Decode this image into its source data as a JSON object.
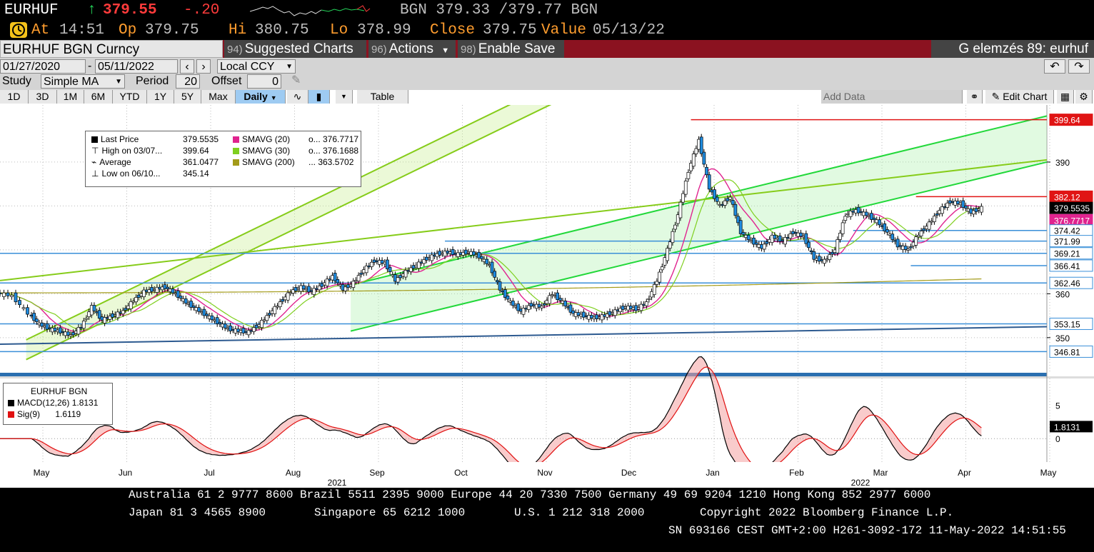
{
  "ticker": {
    "symbol": "EURHUF",
    "arrow": "↑",
    "last": "379.55",
    "change": "-.20",
    "bid_ask": "BGN 379.33 /379.77 BGN",
    "at_label": "At",
    "at": "14:51",
    "op_label": "Op",
    "op": "379.75",
    "hi_label": "Hi",
    "hi": "380.75",
    "lo_label": "Lo",
    "lo": "378.99",
    "close_label": "Close",
    "close": "379.75",
    "value_label": "Value",
    "value": "05/13/22"
  },
  "commandbar": {
    "security": "EURHUF BGN Curncy",
    "suggested_num": "94)",
    "suggested": "Suggested Charts",
    "actions_num": "96)",
    "actions": "Actions",
    "enable_num": "98)",
    "enable": "Enable Save",
    "right_title": "G elemzés 89: eurhuf"
  },
  "toolbar": {
    "date_from": "01/27/2020",
    "date_sep": "-",
    "date_to": "05/11/2022",
    "currency": "Local CCY",
    "study_label": "Study",
    "study": "Simple MA",
    "period_label": "Period",
    "period": "20",
    "offset_label": "Offset",
    "offset": "0",
    "ranges": [
      "1D",
      "3D",
      "1M",
      "6M",
      "YTD",
      "1Y",
      "5Y",
      "Max"
    ],
    "freq": "Daily",
    "table": "Table",
    "add_data": "Add Data",
    "edit_chart": "Edit Chart"
  },
  "colors": {
    "price_up": "#ffffff",
    "price_down": "#1f8ce0",
    "sma20": "#e0238f",
    "sma30": "#7fcf1f",
    "sma200": "#a39b1a",
    "macd": "#000000",
    "signal": "#e01010",
    "channel_green": "#22d83a",
    "channel_lime": "#86cc1a",
    "support_blue": "#3a8fd8"
  },
  "chart_data": [
    {
      "type": "candlestick",
      "title": "",
      "x_axis": {
        "months": [
          "May",
          "Jun",
          "Jul",
          "Aug",
          "Sep",
          "Oct",
          "Nov",
          "Dec",
          "Jan",
          "Feb",
          "Mar",
          "Apr",
          "May"
        ],
        "years": [
          "2021",
          "2022"
        ]
      },
      "y_axis": {
        "ticks": [
          350,
          360,
          390
        ],
        "ylim": [
          342,
          403
        ]
      },
      "legend_position": "top-left",
      "legend": [
        {
          "label": "Last Price",
          "value": "379.5535"
        },
        {
          "label": "High on 03/07...",
          "value": "399.64"
        },
        {
          "label": "Average",
          "value": "361.0477"
        },
        {
          "label": "Low on 06/10...",
          "value": "345.14"
        },
        {
          "label": "SMAVG (20)",
          "value": "o... 376.7717"
        },
        {
          "label": "SMAVG (30)",
          "value": "o... 376.1688"
        },
        {
          "label": "SMAVG (200)",
          "value": "... 363.5702"
        }
      ],
      "price_labels": [
        {
          "value": "399.64",
          "level": 399.64,
          "color": "#e01414"
        },
        {
          "value": "382.12",
          "level": 382.12,
          "color": "#e01414"
        },
        {
          "value": "379.5535",
          "level": 379.55,
          "color": "#000000"
        },
        {
          "value": "376.7717",
          "level": 376.77,
          "color": "#e0238f"
        },
        {
          "value": "374.42",
          "level": 374.42,
          "color": "#3a8fd8"
        },
        {
          "value": "371.99",
          "level": 371.99,
          "color": "#3a8fd8"
        },
        {
          "value": "369.21",
          "level": 369.21,
          "color": "#3a8fd8"
        },
        {
          "value": "366.41",
          "level": 366.41,
          "color": "#3a8fd8"
        },
        {
          "value": "362.46",
          "level": 362.46,
          "color": "#3a8fd8"
        },
        {
          "value": "353.15",
          "level": 353.15,
          "color": "#3a8fd8"
        },
        {
          "value": "346.81",
          "level": 346.81,
          "color": "#3a8fd8"
        }
      ],
      "price_path": [
        [
          0,
          360.2
        ],
        [
          0.03,
          359.5
        ],
        [
          0.06,
          355.5
        ],
        [
          0.08,
          353.0
        ],
        [
          0.1,
          352.0
        ],
        [
          0.12,
          351.4
        ],
        [
          0.14,
          350.5
        ],
        [
          0.16,
          352.5
        ],
        [
          0.18,
          357.0
        ],
        [
          0.2,
          354.0
        ],
        [
          0.22,
          355.0
        ],
        [
          0.24,
          356.0
        ],
        [
          0.26,
          358.5
        ],
        [
          0.28,
          360.5
        ],
        [
          0.3,
          361.0
        ],
        [
          0.32,
          361.5
        ],
        [
          0.34,
          360.0
        ],
        [
          0.36,
          358.0
        ],
        [
          0.38,
          356.5
        ],
        [
          0.4,
          355.0
        ],
        [
          0.42,
          353.5
        ],
        [
          0.44,
          352.0
        ],
        [
          0.46,
          351.5
        ],
        [
          0.48,
          351.3
        ],
        [
          0.5,
          353.0
        ],
        [
          0.52,
          355.5
        ],
        [
          0.54,
          358.0
        ],
        [
          0.56,
          360.5
        ],
        [
          0.58,
          361.5
        ],
        [
          0.6,
          360.5
        ],
        [
          0.62,
          362.0
        ],
        [
          0.64,
          364.0
        ],
        [
          0.66,
          361.0
        ],
        [
          0.68,
          362.5
        ],
        [
          0.7,
          365.5
        ],
        [
          0.72,
          367.5
        ],
        [
          0.74,
          367.0
        ],
        [
          0.76,
          363.0
        ],
        [
          0.78,
          365.0
        ],
        [
          0.8,
          366.5
        ],
        [
          0.82,
          368.0
        ],
        [
          0.84,
          369.0
        ],
        [
          0.86,
          369.5
        ],
        [
          0.88,
          369.0
        ],
        [
          0.9,
          369.5
        ],
        [
          0.92,
          368.5
        ],
        [
          0.94,
          366.5
        ],
        [
          0.96,
          361.0
        ],
        [
          0.98,
          358.0
        ],
        [
          1.0,
          356.0
        ],
        [
          1.02,
          357.5
        ],
        [
          1.04,
          357.0
        ],
        [
          1.06,
          360.0
        ],
        [
          1.08,
          358.0
        ],
        [
          1.1,
          355.5
        ],
        [
          1.12,
          355.0
        ],
        [
          1.14,
          354.5
        ],
        [
          1.16,
          355.0
        ],
        [
          1.18,
          356.0
        ],
        [
          1.2,
          357.0
        ],
        [
          1.22,
          356.5
        ],
        [
          1.24,
          358.0
        ],
        [
          1.26,
          363.0
        ],
        [
          1.28,
          370.0
        ],
        [
          1.3,
          378.0
        ],
        [
          1.32,
          388.0
        ],
        [
          1.34,
          395.0
        ],
        [
          1.36,
          384.0
        ],
        [
          1.38,
          380.0
        ],
        [
          1.4,
          382.0
        ],
        [
          1.42,
          374.0
        ],
        [
          1.44,
          372.0
        ],
        [
          1.46,
          370.5
        ],
        [
          1.48,
          373.0
        ],
        [
          1.5,
          372.0
        ],
        [
          1.52,
          374.0
        ],
        [
          1.54,
          373.0
        ],
        [
          1.56,
          368.0
        ],
        [
          1.58,
          367.5
        ],
        [
          1.6,
          370.0
        ],
        [
          1.62,
          378.0
        ],
        [
          1.64,
          379.0
        ],
        [
          1.66,
          378.0
        ],
        [
          1.68,
          376.5
        ],
        [
          1.7,
          374.0
        ],
        [
          1.72,
          371.0
        ],
        [
          1.74,
          370.0
        ],
        [
          1.76,
          373.5
        ],
        [
          1.78,
          376.0
        ],
        [
          1.8,
          379.0
        ],
        [
          1.82,
          381.0
        ],
        [
          1.84,
          380.5
        ],
        [
          1.86,
          378.5
        ],
        [
          1.88,
          379.55
        ]
      ]
    },
    {
      "type": "line",
      "title": "EURHUF BGN",
      "series": [
        {
          "name": "MACD(12,26)",
          "last": "1.8131",
          "color": "#000000"
        },
        {
          "name": "Sig(9)",
          "last": "1.6119",
          "color": "#e01010"
        }
      ],
      "y_axis": {
        "ticks": [
          5,
          0
        ]
      },
      "last_label": "1.8131"
    }
  ],
  "footer": {
    "line1": "Australia 61 2 9777 8600 Brazil 5511 2395 9000 Europe 44 20 7330 7500 Germany 49 69 9204 1210 Hong Kong 852 2977 6000",
    "line2a": "Japan 81 3 4565 8900",
    "line2b": "Singapore 65 6212 1000",
    "line2c": "U.S. 1 212 318 2000",
    "line2d": "Copyright 2022 Bloomberg Finance L.P.",
    "line3": "SN 693166 CEST GMT+2:00 H261-3092-172 11-May-2022 14:51:55"
  }
}
